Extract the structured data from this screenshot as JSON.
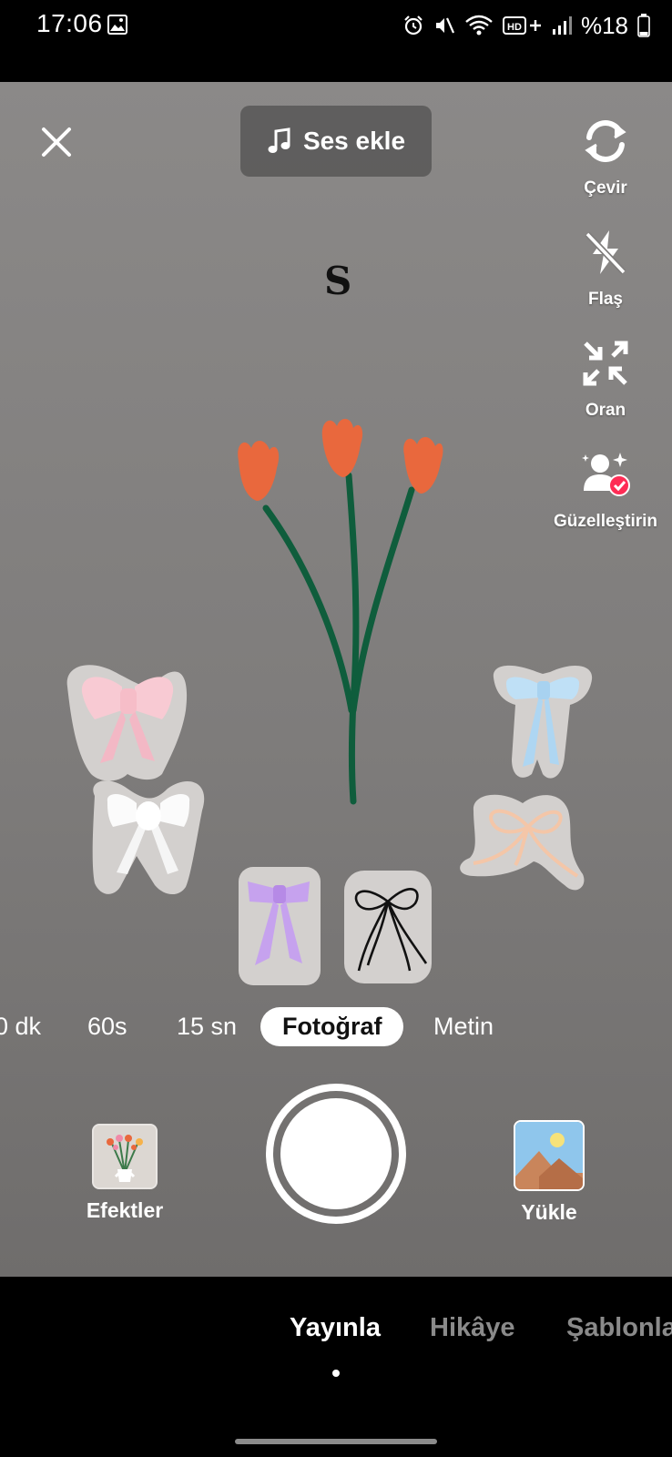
{
  "status_bar": {
    "time": "17:06",
    "battery": "%18",
    "network": "HD+"
  },
  "top": {
    "add_sound_label": "Ses ekle"
  },
  "tools": [
    {
      "label": "Çevir",
      "icon": "flip-camera-icon"
    },
    {
      "label": "Flaş",
      "icon": "flash-off-icon"
    },
    {
      "label": "Oran",
      "icon": "ratio-icon"
    },
    {
      "label": "Güzelleştirin",
      "icon": "beautify-icon"
    }
  ],
  "effect": {
    "letter": "S"
  },
  "modes": {
    "items": [
      "0 dk",
      "60s",
      "15 sn",
      "Fotoğraf",
      "Metin"
    ],
    "active": "Fotoğraf"
  },
  "bottom": {
    "effects_label": "Efektler",
    "upload_label": "Yükle"
  },
  "tabs": {
    "items": [
      "Yayınla",
      "Hikâye",
      "Şablonlar"
    ],
    "active": "Yayınla"
  },
  "colors": {
    "tulip": "#e9683d",
    "stem": "#0f5d3c",
    "viewfinder": "#848281",
    "badge": "#fe2c55"
  }
}
